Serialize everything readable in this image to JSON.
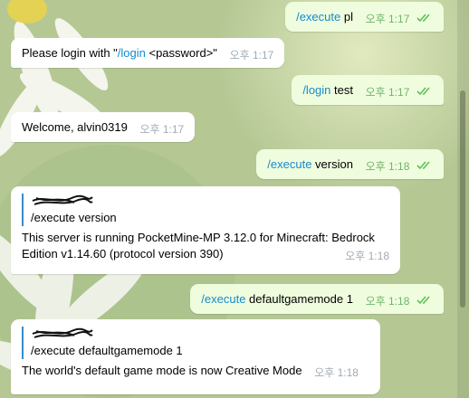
{
  "messages": [
    {
      "cmd": "/execute",
      "rest": " pl",
      "time": "오후 1:17"
    },
    {
      "pre": "Please login with \"",
      "cmd": "/login",
      "post": " <password>\"",
      "time": "오후 1:17"
    },
    {
      "cmd": "/login",
      "rest": " test",
      "time": "오후 1:17"
    },
    {
      "text": "Welcome, alvin0319",
      "time": "오후 1:17"
    },
    {
      "cmd": "/execute",
      "rest": " version",
      "time": "오후 1:18"
    },
    {
      "quote": "/execute version",
      "text": "This server is running PocketMine-MP 3.12.0 for Minecraft: Bedrock Edition v1.14.60 (protocol version 390)",
      "time": "오후 1:18"
    },
    {
      "cmd": "/execute",
      "rest": " defaultgamemode 1",
      "time": "오후 1:18"
    },
    {
      "quote": "/execute defaultgamemode 1",
      "text": "The world's default game mode is now Creative Mode",
      "time": "오후 1:18"
    }
  ],
  "colors": {
    "command": "#168acd",
    "outgoing_bubble": "#effdde",
    "quote_bar": "#3a8bc8"
  },
  "icons": {
    "read_receipt": "double-check-icon"
  }
}
